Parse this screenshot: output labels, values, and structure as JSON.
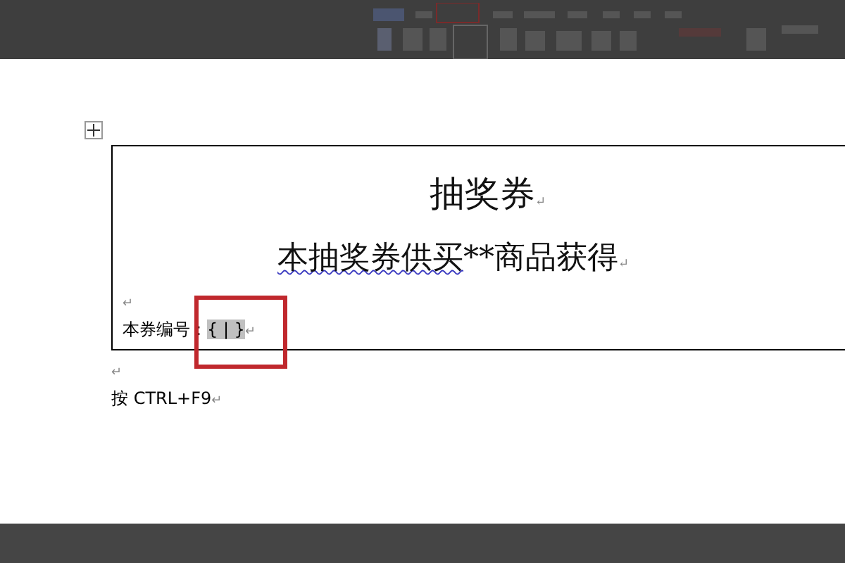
{
  "document": {
    "table": {
      "title": {
        "text": "抽奖券",
        "mark": "↵"
      },
      "subtitle": {
        "parts": [
          {
            "text": "本抽奖券供买",
            "spellcheck": true
          },
          {
            "text": "**商品获得",
            "spellcheck": false
          }
        ],
        "mark": "↵"
      },
      "empty_mark": "↵",
      "serial": {
        "label": "本券编号：",
        "field_code": "{ | }",
        "highlighted": true,
        "mark": "↵"
      }
    },
    "after_mark": "↵",
    "instruction": {
      "text": "按 CTRL+F9",
      "mark": "↵"
    }
  }
}
